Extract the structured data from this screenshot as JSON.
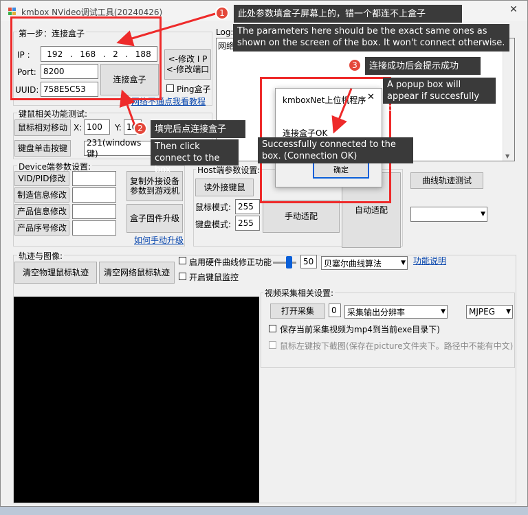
{
  "window": {
    "title": "kmbox NVideo调试工具(20240426)",
    "close_glyph": "✕"
  },
  "step1": {
    "title": "第一步：连接盒子",
    "ip_label": "IP  :",
    "ip": [
      "192",
      "168",
      "2",
      "188"
    ],
    "ip_dot": ".",
    "port_label": "Port:",
    "port": "8200",
    "uuid_label": "UUID:",
    "uuid": "758E5C53",
    "connect_button": "连接盒子",
    "modify_ip_button": "<-修改 I P",
    "modify_port_button": "<-修改端口",
    "ping_label": "Ping盒子",
    "help_link": "网络不通点我看教程"
  },
  "log": {
    "label": "Log:",
    "line1": "网络连接正常"
  },
  "kbmouse": {
    "title": "键鼠相关功能测试:",
    "mouse_move_button": "鼠标相对移动",
    "x_label": "X:",
    "x_value": "100",
    "y_label": "Y:",
    "y_value": "100",
    "key_click_button": "键盘单击按键",
    "key_select": "231(windows键)"
  },
  "device": {
    "title": "Device端参数设置:",
    "vidpid_button": "VID/PID修改",
    "maker_button": "制造信息修改",
    "product_button": "产品信息修改",
    "serial_button": "产品序号修改",
    "copy_button": "复制外接设备参数到游戏机",
    "firmware_button": "盒子固件升级",
    "manual_upgrade_link": "如何手动升级"
  },
  "host": {
    "title": "Host端参数设置:",
    "read_button": "读外接键鼠",
    "mouse_mode_label": "鼠标模式:",
    "mouse_mode_value": "255",
    "kb_mode_label": "键盘模式:",
    "kb_mode_value": "255",
    "manual_adapt_button": "手动适配",
    "auto_adapt_button": "自动适配"
  },
  "curve_test_button": "曲线轨迹测试",
  "track": {
    "title": "轨迹与图像:",
    "clear_physical_button": "清空物理鼠标轨迹",
    "clear_network_button": "清空网络鼠标轨迹",
    "hw_curve_label": "启用硬件曲线修正功能",
    "slider_value": "50",
    "curve_algo_select": "贝塞尔曲线算法",
    "func_link": "功能说明",
    "kb_monitor_label": "开启键鼠监控"
  },
  "video": {
    "title": "视频采集相关设置:",
    "open_button": "打开采集",
    "index_value": "0",
    "resolution_select": "采集输出分辨率",
    "format_select": "MJPEG",
    "save_mp4_label": "保存当前采集视频为mp4到当前exe目录下)",
    "screenshot_label": "鼠标左键按下截图(保存在picture文件夹下。路径中不能有中文)"
  },
  "popup": {
    "title": "kmboxNet上位机程序",
    "message": "连接盒子OK",
    "ok_button": "确定",
    "close_glyph": "✕"
  },
  "annotations": {
    "badge1": "1",
    "callout1_cn": "此处参数填盒子屏幕上的，错一个都连不上盒子",
    "callout1_en": "The parameters here should be the exact same ones as shown on the screen of the box. It won't connect otherwise.",
    "badge2": "2",
    "callout2_cn": "填完后点连接盒子",
    "callout2_en": "Then click connect to the box",
    "badge3": "3",
    "callout3_cn": "连接成功后会提示成功",
    "callout3_en": "A popup box will appear if succesfully connected",
    "popup_caption_en": "Successfully connected to the box. (Connection OK)",
    "accent_red": "#ee2a2a",
    "badge_red": "#e4473a"
  }
}
